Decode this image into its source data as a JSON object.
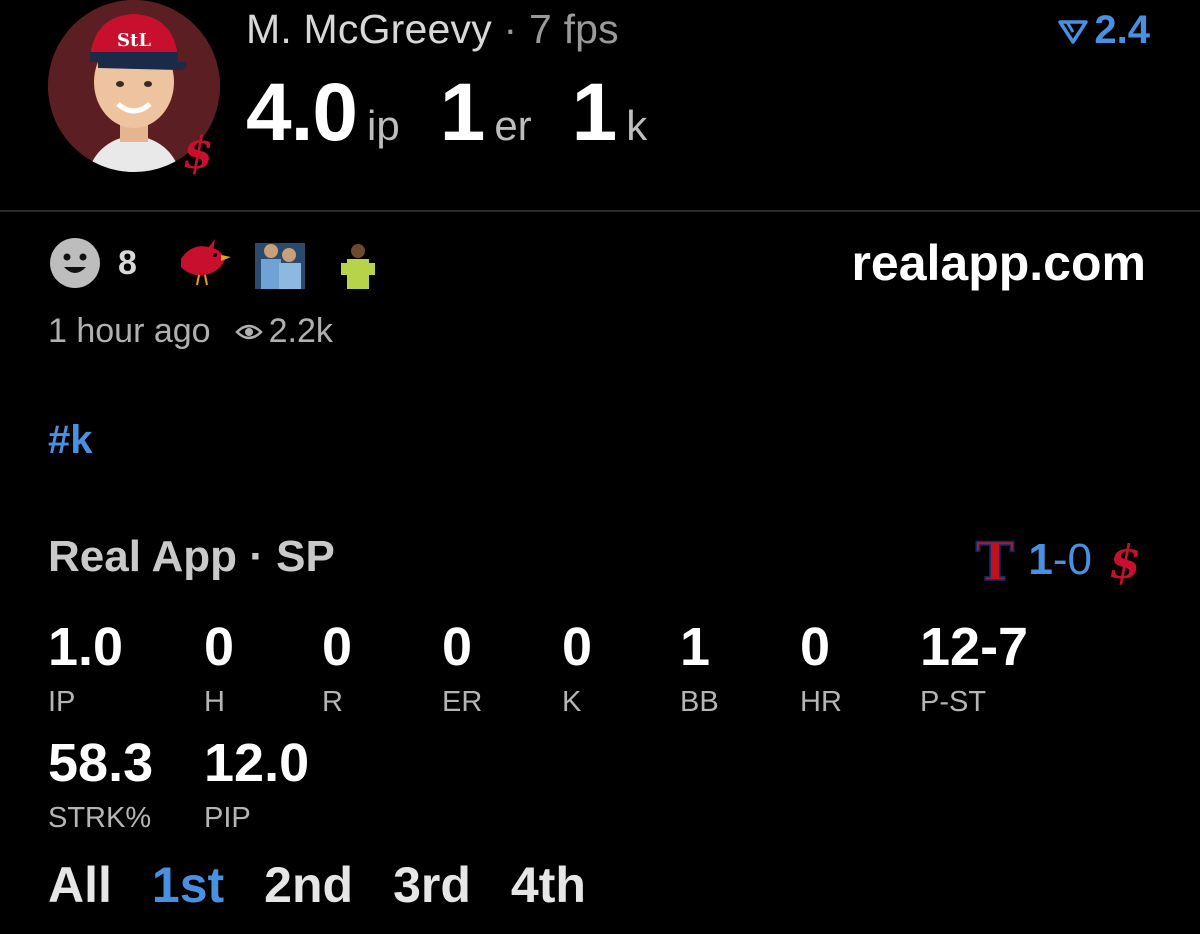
{
  "header": {
    "player_name": "M. McGreevy",
    "separator": " · ",
    "fps": "7 fps",
    "rating_value": "2.4",
    "statline": [
      {
        "value": "4.0",
        "unit": "ip"
      },
      {
        "value": "1",
        "unit": "er"
      },
      {
        "value": "1",
        "unit": "k"
      }
    ]
  },
  "reactions": {
    "count": "8",
    "site": "realapp.com"
  },
  "meta": {
    "time_ago": "1 hour ago",
    "views": "2.2k"
  },
  "hashtag": "#k",
  "game": {
    "title": "Real App · SP",
    "score_home": "1",
    "score_sep": "-0",
    "stats": [
      {
        "value": "1.0",
        "label": "IP"
      },
      {
        "value": "0",
        "label": "H"
      },
      {
        "value": "0",
        "label": "R"
      },
      {
        "value": "0",
        "label": "ER"
      },
      {
        "value": "0",
        "label": "K"
      },
      {
        "value": "1",
        "label": "BB"
      },
      {
        "value": "0",
        "label": "HR"
      },
      {
        "value": "12-7",
        "label": "P-ST"
      },
      {
        "value": "58.3",
        "label": "STRK%"
      },
      {
        "value": "12.0",
        "label": "PIP"
      }
    ]
  },
  "tabs": [
    "All",
    "1st",
    "2nd",
    "3rd",
    "4th"
  ],
  "active_tab": "1st",
  "colors": {
    "accent": "#4a90e2",
    "cardinals_red": "#c8102e",
    "rangers_red": "#c0111f",
    "rangers_blue": "#003278"
  }
}
